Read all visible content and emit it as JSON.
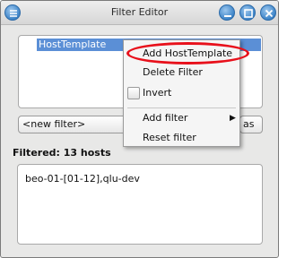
{
  "window": {
    "title": "Filter Editor"
  },
  "filter_list": {
    "items": [
      "HostTemplate"
    ]
  },
  "filter_select": {
    "value": "<new filter>"
  },
  "save_as_button": {
    "label": "as"
  },
  "filtered": {
    "label": "Filtered: 13 hosts",
    "hosts_text": "beo-01-[01-12],qlu-dev"
  },
  "context_menu": {
    "add_template": "Add HostTemplate",
    "delete_filter": "Delete Filter",
    "invert": "Invert",
    "add_filter": "Add filter",
    "reset_filter": "Reset filter"
  },
  "colors": {
    "selection": "#5b8fd6",
    "highlight_ring": "#e8101b",
    "titlebar_buttons": "#3d84c8"
  }
}
